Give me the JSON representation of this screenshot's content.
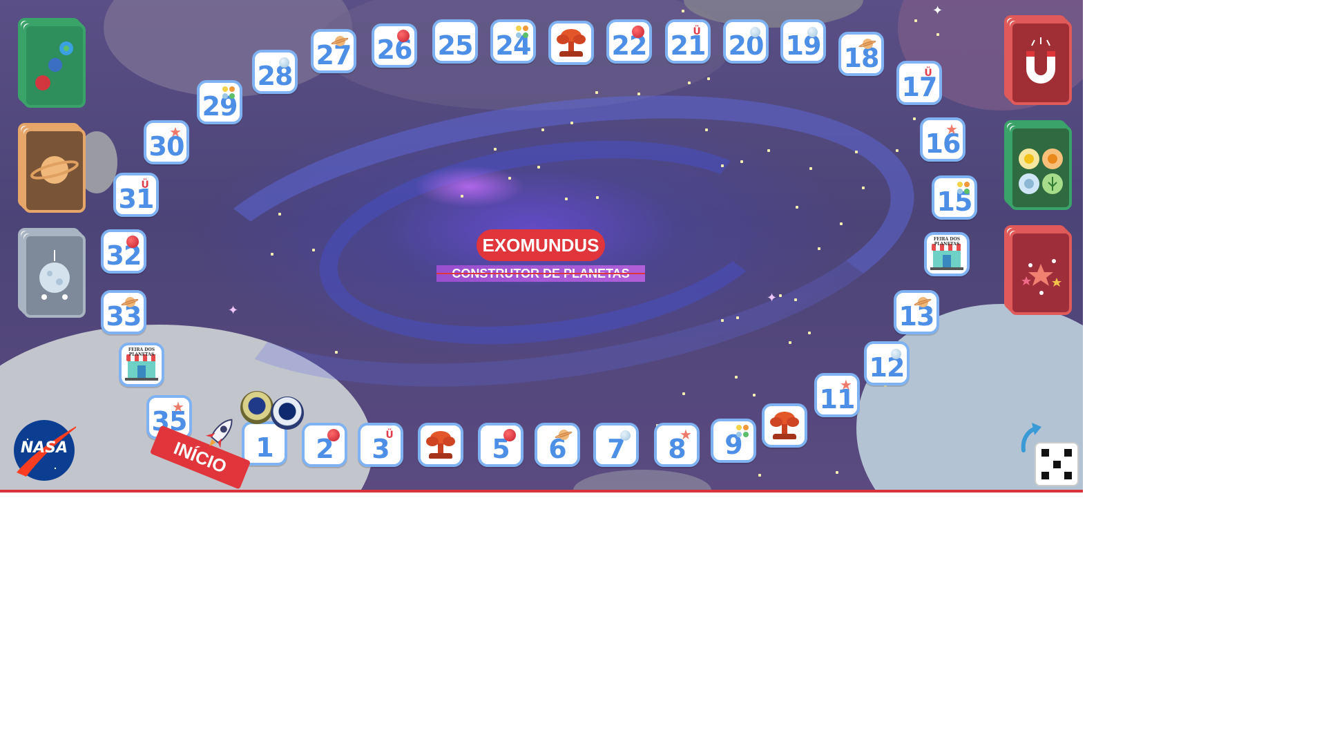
{
  "game": {
    "title": "EXOMUNDUS",
    "subtitle": "CONSTRUTOR DE PLANETAS",
    "start_label": "INÍCIO",
    "logo_text": "NASA",
    "shop_sign": "FEIRA DOS PLANETAS"
  },
  "colors": {
    "tile_border": "#7fb2f2",
    "tile_number": "#4d8fe6",
    "title_bg": "#e0353b",
    "subtitle_bg": "#9a4fd0",
    "board_bg": "#4c4477"
  },
  "tiles": [
    {
      "label": "1",
      "mark": ""
    },
    {
      "label": "2",
      "mark": "red-planet-icon"
    },
    {
      "label": "3",
      "mark": "magnet-icon"
    },
    {
      "label": "",
      "mark": "volcano-icon"
    },
    {
      "label": "5",
      "mark": "red-planet-icon"
    },
    {
      "label": "6",
      "mark": "saturn-icon"
    },
    {
      "label": "7",
      "mark": "moon-icon"
    },
    {
      "label": "8",
      "mark": "star-icon"
    },
    {
      "label": "9",
      "mark": "climate-icon"
    },
    {
      "label": "",
      "mark": "volcano-icon"
    },
    {
      "label": "11",
      "mark": "star-icon"
    },
    {
      "label": "12",
      "mark": "moon-icon"
    },
    {
      "label": "13",
      "mark": "saturn-icon"
    },
    {
      "label": "",
      "mark": "shop-icon"
    },
    {
      "label": "15",
      "mark": "climate-icon"
    },
    {
      "label": "16",
      "mark": "star-icon"
    },
    {
      "label": "17",
      "mark": "magnet-icon"
    },
    {
      "label": "18",
      "mark": "saturn-icon"
    },
    {
      "label": "19",
      "mark": "moon-icon"
    },
    {
      "label": "20",
      "mark": "moon-icon"
    },
    {
      "label": "21",
      "mark": "magnet-icon"
    },
    {
      "label": "22",
      "mark": "red-planet-icon"
    },
    {
      "label": "",
      "mark": "volcano-icon"
    },
    {
      "label": "24",
      "mark": "climate-icon"
    },
    {
      "label": "25",
      "mark": ""
    },
    {
      "label": "26",
      "mark": "red-planet-icon"
    },
    {
      "label": "27",
      "mark": "saturn-icon"
    },
    {
      "label": "28",
      "mark": "moon-icon"
    },
    {
      "label": "29",
      "mark": "climate-icon"
    },
    {
      "label": "30",
      "mark": "star-icon"
    },
    {
      "label": "31",
      "mark": "magnet-icon"
    },
    {
      "label": "32",
      "mark": "red-planet-icon"
    },
    {
      "label": "33",
      "mark": "saturn-icon"
    },
    {
      "label": "",
      "mark": "shop-icon"
    },
    {
      "label": "35",
      "mark": "star-icon"
    }
  ],
  "decks_left": [
    {
      "name": "planets-deck",
      "icon": "planets-icon",
      "color": "#3aa36a",
      "face": "#2f8f5c"
    },
    {
      "name": "saturn-deck",
      "icon": "saturn-icon",
      "color": "#e6a66a",
      "face": "#7a5436"
    },
    {
      "name": "moon-deck",
      "icon": "moon-icon",
      "color": "#a9b4c2",
      "face": "#7e8a99"
    }
  ],
  "decks_right": [
    {
      "name": "magnet-deck",
      "icon": "magnet-icon",
      "color": "#e05a5a",
      "face": "#a02f35"
    },
    {
      "name": "climate-deck",
      "icon": "climate-icon",
      "color": "#3aa36a",
      "face": "#2f6a40"
    },
    {
      "name": "stars-deck",
      "icon": "stars-icon",
      "color": "#e05a5a",
      "face": "#9e2f3a"
    }
  ],
  "dice": {
    "face": 5
  }
}
